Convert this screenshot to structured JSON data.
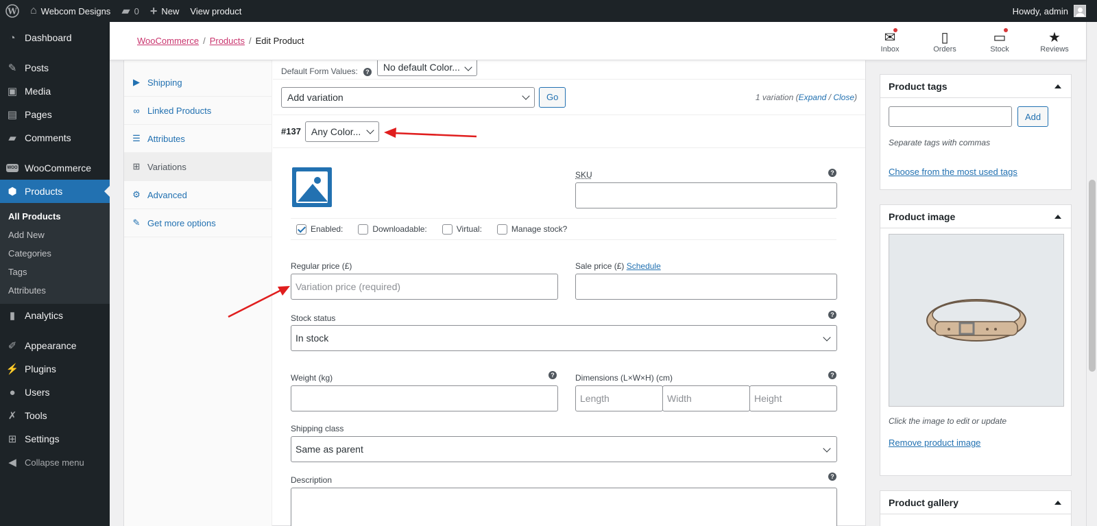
{
  "adminbar": {
    "site_name": "Webcom Designs",
    "comments_count": "0",
    "new_label": "New",
    "view_product": "View product",
    "howdy": "Howdy, admin"
  },
  "sidebar": {
    "dashboard": "Dashboard",
    "posts": "Posts",
    "media": "Media",
    "pages": "Pages",
    "comments": "Comments",
    "woocommerce": "WooCommerce",
    "products": "Products",
    "sub": [
      "All Products",
      "Add New",
      "Categories",
      "Tags",
      "Attributes"
    ],
    "analytics": "Analytics",
    "appearance": "Appearance",
    "plugins": "Plugins",
    "users": "Users",
    "tools": "Tools",
    "settings": "Settings",
    "collapse": "Collapse menu"
  },
  "header": {
    "crumb_woocommerce": "WooCommerce",
    "crumb_products": "Products",
    "crumb_current": "Edit Product",
    "icons": [
      "Inbox",
      "Orders",
      "Stock",
      "Reviews"
    ]
  },
  "tabs": [
    "Shipping",
    "Linked Products",
    "Attributes",
    "Variations",
    "Advanced",
    "Get more options"
  ],
  "variations": {
    "default_label": "Default Form Values:",
    "default_select": "No default Color...",
    "add_variation": "Add variation",
    "go": "Go",
    "count_text": "1 variation (",
    "expand": "Expand",
    "slash": " / ",
    "close": "Close",
    "close_paren": ")",
    "var_number": "#137",
    "var_select": "Any Color...",
    "sku_label": "SKU",
    "enabled": "Enabled:",
    "downloadable": "Downloadable:",
    "virtual": "Virtual:",
    "manage_stock": "Manage stock?",
    "regular_price_label": "Regular price (£)",
    "regular_price_placeholder": "Variation price (required)",
    "sale_price_label": "Sale price (£)",
    "schedule": "Schedule",
    "stock_status_label": "Stock status",
    "stock_status_value": "In stock",
    "weight_label": "Weight (kg)",
    "dimensions_label": "Dimensions (L×W×H) (cm)",
    "length": "Length",
    "width": "Width",
    "height": "Height",
    "shipping_class_label": "Shipping class",
    "shipping_class_value": "Same as parent",
    "description_label": "Description"
  },
  "product_tags": {
    "title": "Product tags",
    "add": "Add",
    "hint": "Separate tags with commas",
    "most_used": "Choose from the most used tags"
  },
  "product_image": {
    "title": "Product image",
    "hint": "Click the image to edit or update",
    "remove": "Remove product image"
  },
  "product_gallery": {
    "title": "Product gallery"
  },
  "colors": {
    "admin_dark": "#1d2327",
    "accent": "#2271b1",
    "breadcrumb_link": "#c9356e",
    "annotation": "#e01e1e"
  }
}
